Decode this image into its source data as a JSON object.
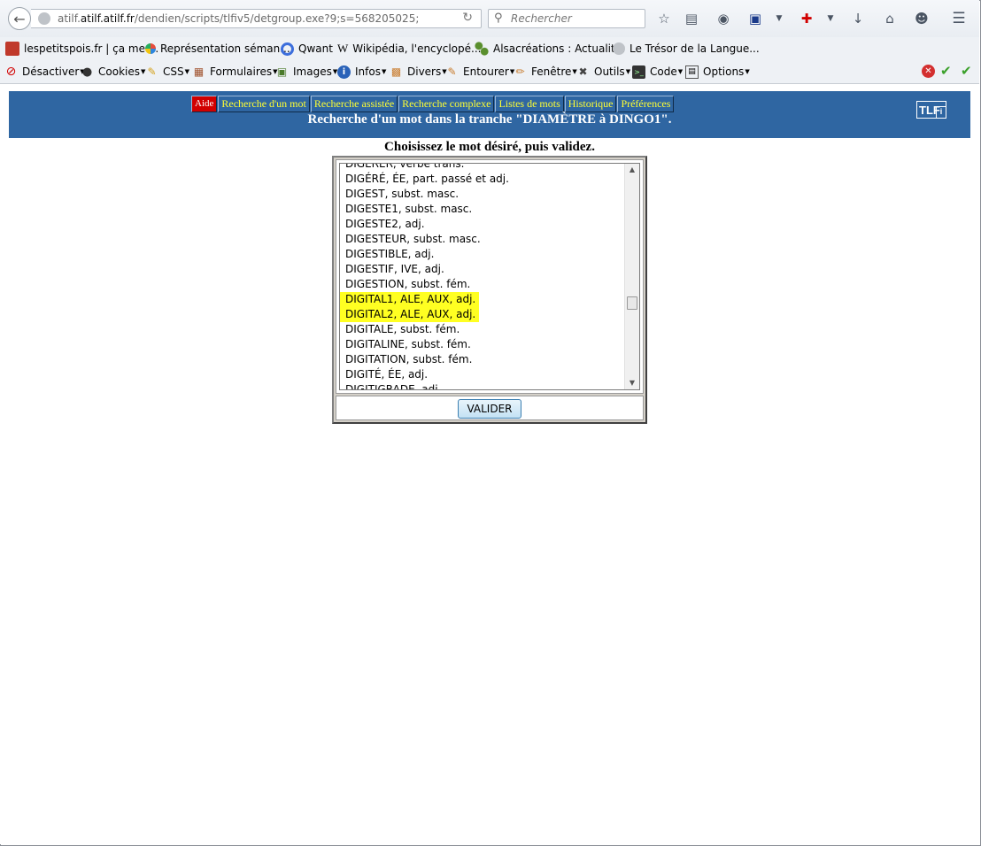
{
  "browser": {
    "url_domain": "atilf.atilf.fr",
    "url_prefix": "atilf.",
    "url_rest": "/dendien/scripts/tlfiv5/detgroup.exe?9;s=568205025;",
    "search_placeholder": "Rechercher"
  },
  "bookmarks": [
    {
      "label": "lespetitspois.fr | ça me ...",
      "icon": "lespetitspois-icon",
      "color": "#c0392b"
    },
    {
      "label": "Représentation séman...",
      "icon": "pinwheel-icon",
      "color": "#2e86de"
    },
    {
      "label": "Qwant",
      "icon": "qwant-icon",
      "color": "#3c6edc"
    },
    {
      "label": "Wikipédia, l'encyclopé...",
      "icon": "wikipedia-icon",
      "color": "#333333"
    },
    {
      "label": "Alsacréations : Actualit...",
      "icon": "alsacreations-icon",
      "color": "#5a8f2e"
    },
    {
      "label": "Le Trésor de la Langue...",
      "icon": "globe-icon",
      "color": "#9aa0a6"
    }
  ],
  "toolbar": [
    {
      "label": "Désactiver",
      "icon": "disable-icon"
    },
    {
      "label": "Cookies",
      "icon": "cookies-icon"
    },
    {
      "label": "CSS",
      "icon": "css-icon"
    },
    {
      "label": "Formulaires",
      "icon": "forms-icon"
    },
    {
      "label": "Images",
      "icon": "images-icon"
    },
    {
      "label": "Infos",
      "icon": "info-icon"
    },
    {
      "label": "Divers",
      "icon": "misc-icon"
    },
    {
      "label": "Entourer",
      "icon": "outline-icon"
    },
    {
      "label": "Fenêtre",
      "icon": "resize-icon"
    },
    {
      "label": "Outils",
      "icon": "tools-icon"
    },
    {
      "label": "Code",
      "icon": "code-icon"
    },
    {
      "label": "Options",
      "icon": "options-icon"
    }
  ],
  "page": {
    "tabs": [
      "Aide",
      "Recherche d'un mot",
      "Recherche assistée",
      "Recherche complexe",
      "Listes de mots",
      "Historique",
      "Préférences"
    ],
    "banner_title": "Recherche d'un mot dans la tranche \"DIAMÈTRE à DINGO1\".",
    "logo_text": "TLF",
    "logo_sub": "i",
    "instruction": "Choisissez le mot désiré, puis validez.",
    "list_items": [
      {
        "text": "DIGÉRER, verbe trans.",
        "selected": false
      },
      {
        "text": "DIGÉRÉ, ÉE, part. passé et adj.",
        "selected": false
      },
      {
        "text": "DIGEST, subst. masc.",
        "selected": false
      },
      {
        "text": "DIGESTE1, subst. masc.",
        "selected": false
      },
      {
        "text": "DIGESTE2, adj.",
        "selected": false
      },
      {
        "text": "DIGESTEUR, subst. masc.",
        "selected": false
      },
      {
        "text": "DIGESTIBLE, adj.",
        "selected": false
      },
      {
        "text": "DIGESTIF, IVE, adj.",
        "selected": false
      },
      {
        "text": "DIGESTION, subst. fém.",
        "selected": false
      },
      {
        "text": "DIGITAL1, ALE, AUX, adj.",
        "selected": true
      },
      {
        "text": "DIGITAL2, ALE, AUX, adj.",
        "selected": true
      },
      {
        "text": "DIGITALE, subst. fém.",
        "selected": false
      },
      {
        "text": "DIGITALINE, subst. fém.",
        "selected": false
      },
      {
        "text": "DIGITATION, subst. fém.",
        "selected": false
      },
      {
        "text": "DIGITÉ, ÉE, adj.",
        "selected": false
      },
      {
        "text": "DIGITIGRADE, adj.",
        "selected": false
      }
    ],
    "submit_label": "VALIDER"
  },
  "colors": {
    "banner": "#2f66a2",
    "tab_text": "#ffff33",
    "help_tab": "#d10000",
    "highlight": "#ffff22"
  }
}
